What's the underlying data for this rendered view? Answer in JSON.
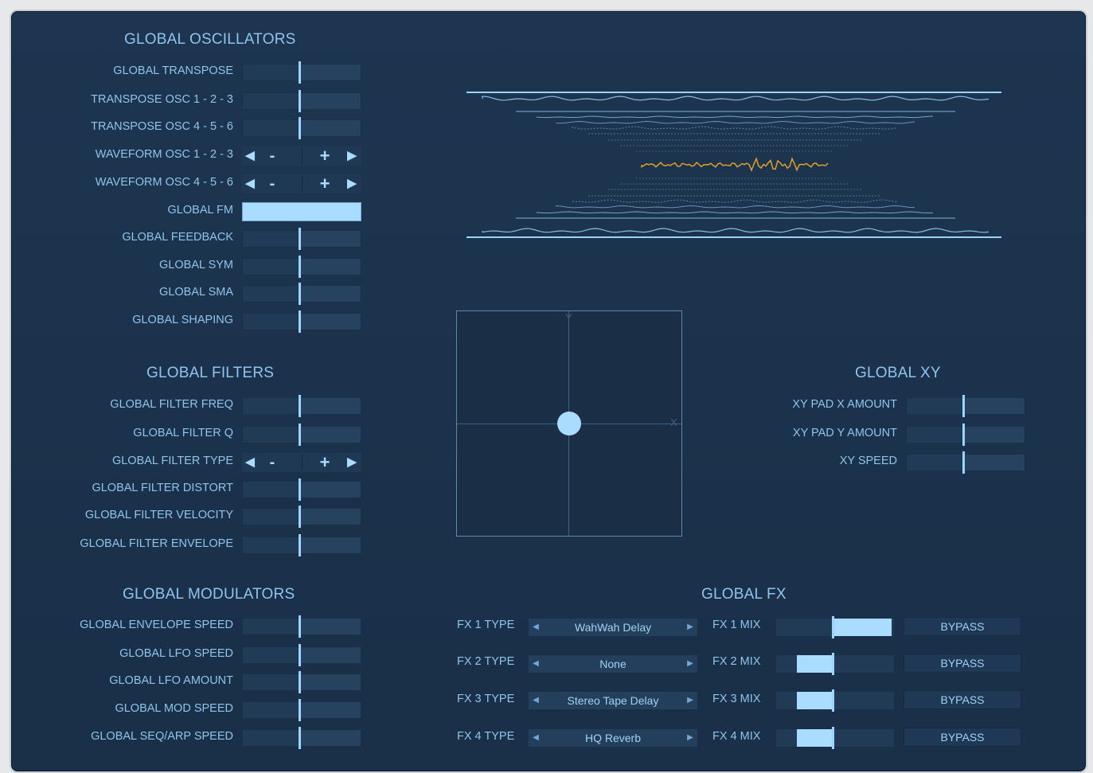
{
  "colors": {
    "accent": "#8fc4ec",
    "fill": "#a9dcff",
    "wave_highlight": "#e0a02a",
    "panel": "#1d3550"
  },
  "oscillators": {
    "title": "GLOBAL OSCILLATORS",
    "global_transpose": "GLOBAL TRANSPOSE",
    "transpose_123": "TRANSPOSE OSC 1 - 2 - 3",
    "transpose_456": "TRANSPOSE OSC 4 - 5 - 6",
    "waveform_123": "WAVEFORM OSC 1 - 2 - 3",
    "waveform_456": "WAVEFORM OSC 4 - 5 - 6",
    "global_fm": "GLOBAL FM",
    "global_feedback": "GLOBAL FEEDBACK",
    "global_sym": "GLOBAL SYM",
    "global_sma": "GLOBAL SMA",
    "global_shaping": "GLOBAL SHAPING"
  },
  "filters": {
    "title": "GLOBAL FILTERS",
    "freq": "GLOBAL FILTER FREQ",
    "q": "GLOBAL FILTER Q",
    "type": "GLOBAL FILTER TYPE",
    "distort": "GLOBAL FILTER DISTORT",
    "velocity": "GLOBAL FILTER VELOCITY",
    "envelope": "GLOBAL FILTER ENVELOPE"
  },
  "modulators": {
    "title": "GLOBAL MODULATORS",
    "envelope_speed": "GLOBAL ENVELOPE SPEED",
    "lfo_speed": "GLOBAL LFO SPEED",
    "lfo_amount": "GLOBAL LFO AMOUNT",
    "mod_speed": "GLOBAL MOD SPEED",
    "seq_arp_speed": "GLOBAL SEQ/ARP SPEED"
  },
  "stepper": {
    "minus": "-",
    "plus": "+"
  },
  "xy": {
    "title": "GLOBAL XY",
    "x_amount": "XY PAD X AMOUNT",
    "y_amount": "XY PAD Y AMOUNT",
    "speed": "XY SPEED",
    "axis_x": "X",
    "axis_y": "Y"
  },
  "fx": {
    "title": "GLOBAL FX",
    "bypass": "BYPASS",
    "rows": [
      {
        "type_label": "FX 1 TYPE",
        "type_value": "WahWah Delay",
        "mix_label": "FX 1 MIX",
        "mix": 0.5
      },
      {
        "type_label": "FX 2 TYPE",
        "type_value": "None",
        "mix_label": "FX 2 MIX",
        "mix": 0.5
      },
      {
        "type_label": "FX 3 TYPE",
        "type_value": "Stereo Tape Delay",
        "mix_label": "FX 3 MIX",
        "mix": 0.5
      },
      {
        "type_label": "FX 4 TYPE",
        "type_value": "HQ Reverb",
        "mix_label": "FX 4 MIX",
        "mix": 0.5
      }
    ]
  }
}
